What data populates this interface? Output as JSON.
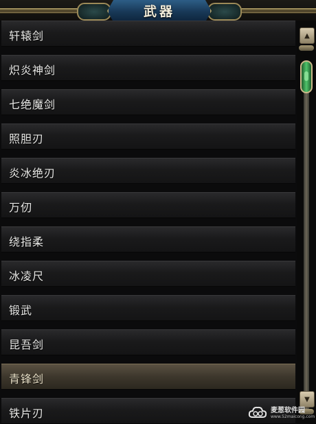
{
  "header": {
    "title": "武器"
  },
  "list": {
    "selected_index": 10,
    "items": [
      {
        "label": "轩辕剑"
      },
      {
        "label": "炽炎神剑"
      },
      {
        "label": "七绝魔剑"
      },
      {
        "label": "照胆刃"
      },
      {
        "label": "炎冰绝刃"
      },
      {
        "label": "万仞"
      },
      {
        "label": "绕指柔"
      },
      {
        "label": "冰凌尺"
      },
      {
        "label": "锻武"
      },
      {
        "label": "昆吾剑"
      },
      {
        "label": "青锋剑"
      },
      {
        "label": "铁片刃"
      }
    ]
  },
  "scrollbar": {
    "position_fraction": 0.0
  },
  "watermark": {
    "name": "麦葱软件园",
    "url": "www.52maicong.com"
  },
  "colors": {
    "title_plate": "#1f4a70",
    "row_text": "#e8e8e6",
    "selected_row": "#4a4336",
    "scroll_thumb": "#3fae5a"
  }
}
